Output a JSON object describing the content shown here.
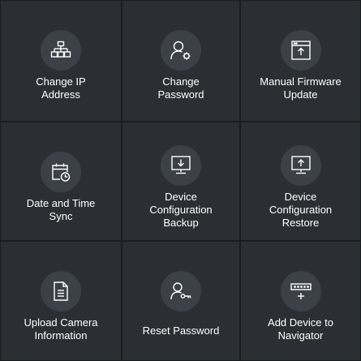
{
  "tiles": [
    {
      "label": "Change IP\nAddress",
      "icon": "network-icon"
    },
    {
      "label": "Change\nPassword",
      "icon": "user-settings-icon"
    },
    {
      "label": "Manual Firmware\nUpdate",
      "icon": "firmware-upload-icon"
    },
    {
      "label": "Date and Time\nSync",
      "icon": "calendar-clock-icon"
    },
    {
      "label": "Device\nConfiguration\nBackup",
      "icon": "monitor-download-icon"
    },
    {
      "label": "Device\nConfiguration\nRestore",
      "icon": "monitor-upload-icon"
    },
    {
      "label": "Upload Camera\nInformation",
      "icon": "document-icon"
    },
    {
      "label": "Reset Password",
      "icon": "user-key-icon"
    },
    {
      "label": "Add Device to\nNavigator",
      "icon": "device-add-icon"
    }
  ]
}
